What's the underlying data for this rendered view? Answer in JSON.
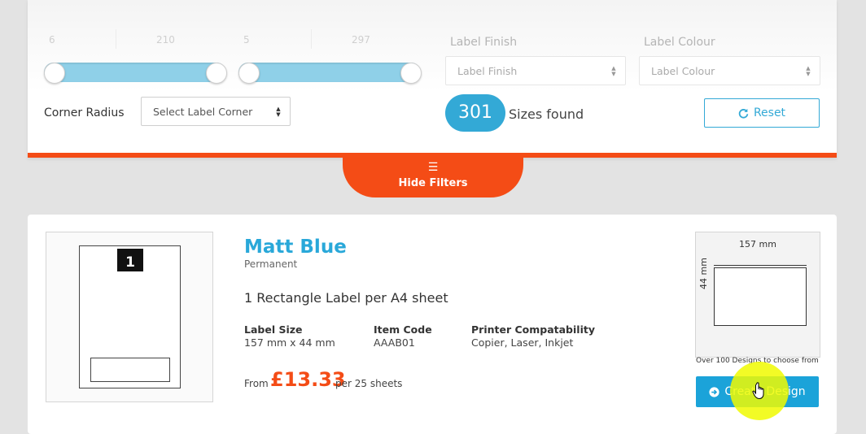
{
  "filters": {
    "width_min": "6",
    "width_max": "210",
    "height_min": "5",
    "height_max": "297",
    "label_finish": {
      "label": "Label Finish",
      "placeholder": "Label Finish"
    },
    "label_colour": {
      "label": "Label Colour",
      "placeholder": "Label Colour"
    },
    "corner_radius": {
      "label": "Corner Radius",
      "placeholder": "Select Label Corner"
    },
    "results_count": "301",
    "results_label": "Sizes found",
    "reset_label": "Reset",
    "hide_filters_label": "Hide Filters"
  },
  "product": {
    "title": "Matt Blue",
    "subtitle": "Permanent",
    "sheet_number": "1",
    "description": "1 Rectangle Label per A4 sheet",
    "specs": [
      {
        "heading": "Label Size",
        "value": "157 mm x 44 mm"
      },
      {
        "heading": "Item Code",
        "value": "AAAB01"
      },
      {
        "heading": "Printer Compatability",
        "value": "Copier, Laser, Inkjet"
      }
    ],
    "price_prefix": "From",
    "price": "£13.33",
    "price_suffix": "per 25 sheets",
    "preview_width": "157 mm",
    "preview_height": "44 mm",
    "designs_note": "Over 100 Designs to choose from",
    "create_label": "Create Design"
  },
  "colors": {
    "accent_orange": "#f44c16",
    "accent_blue": "#29a8d9",
    "slider_fill": "#8fd0e8"
  },
  "icons": {
    "reset": "refresh-icon",
    "hide_filters": "menu-icon",
    "create": "arrow-circle-right-icon",
    "pointer": "hand-cursor-icon"
  }
}
